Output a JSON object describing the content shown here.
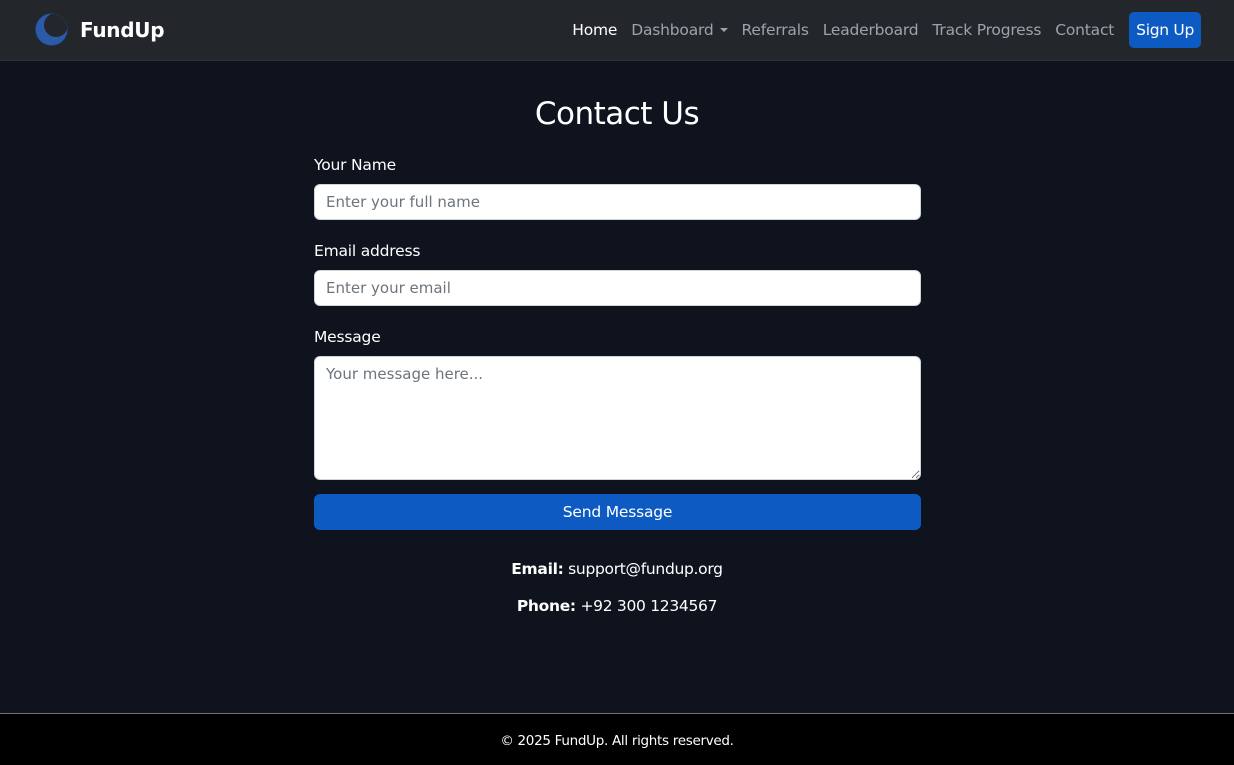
{
  "brand": {
    "name": "FundUp",
    "logo_icon": "crescent-moon-icon",
    "logo_color": "#2a5aa8"
  },
  "nav": {
    "items": [
      {
        "label": "Home",
        "active": true
      },
      {
        "label": "Dashboard",
        "has_dropdown": true
      },
      {
        "label": "Referrals"
      },
      {
        "label": "Leaderboard"
      },
      {
        "label": "Track Progress"
      },
      {
        "label": "Contact"
      }
    ],
    "signup_label": "Sign Up"
  },
  "main": {
    "title": "Contact Us",
    "form": {
      "name_label": "Your Name",
      "name_placeholder": "Enter your full name",
      "name_value": "",
      "email_label": "Email address",
      "email_placeholder": "Enter your email",
      "email_value": "",
      "message_label": "Message",
      "message_placeholder": "Your message here...",
      "message_value": "",
      "submit_label": "Send Message"
    },
    "contact": {
      "email_label": "Email:",
      "email_value": "support@fundup.org",
      "phone_label": "Phone:",
      "phone_value": "+92 300 1234567"
    }
  },
  "footer": {
    "text": "© 2025 FundUp. All rights reserved."
  },
  "colors": {
    "navbar_bg": "#23262b",
    "page_bg": "#0e131d",
    "accent": "#0d5bc2",
    "nav_link": "#9ea3a9",
    "footer_bg": "#000000"
  }
}
